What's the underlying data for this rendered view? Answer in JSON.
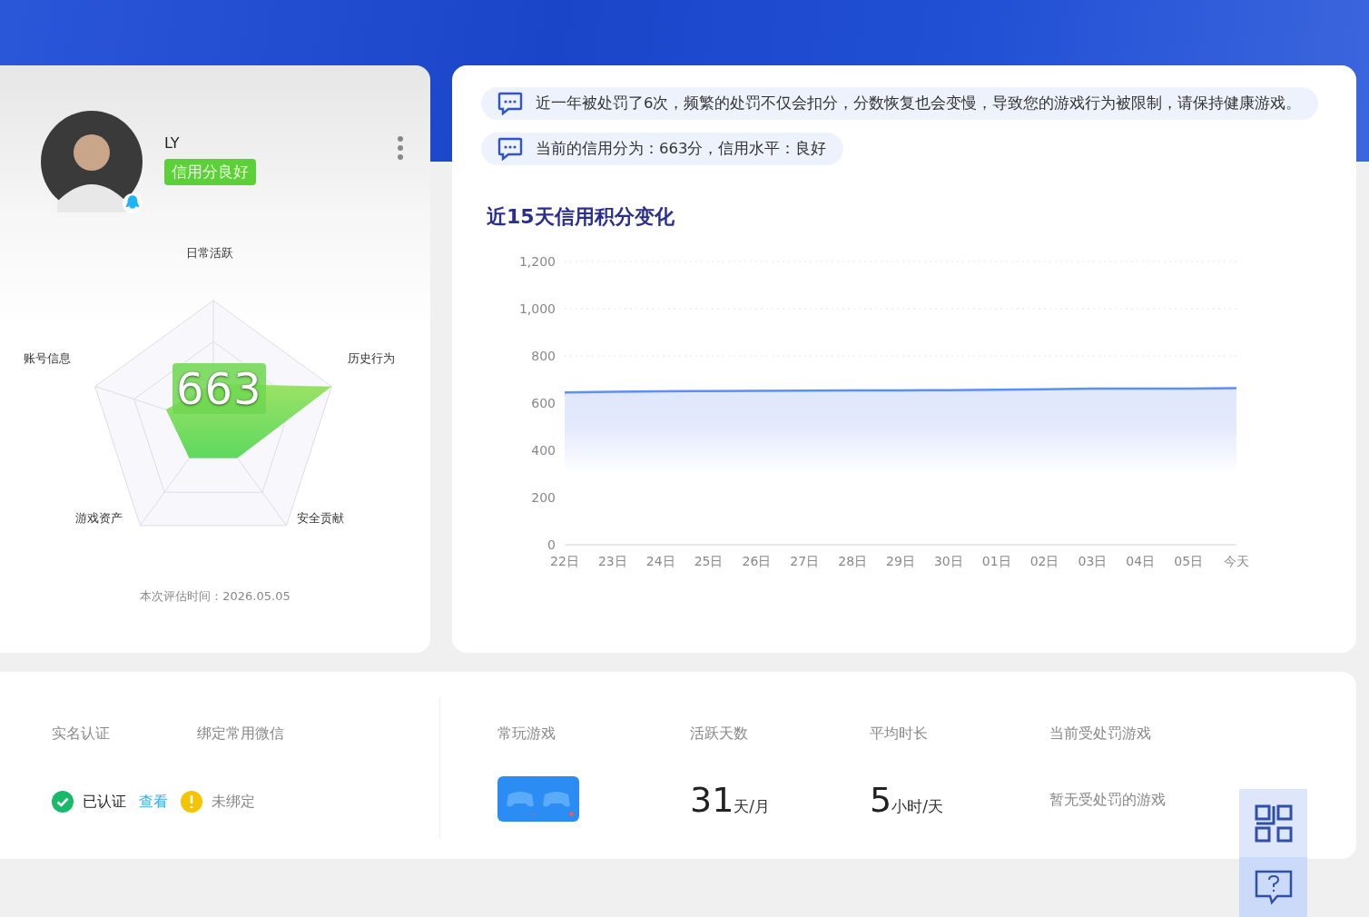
{
  "profile": {
    "name": "LY",
    "badge": "信用分良好",
    "score": "663",
    "radar_labels": [
      "日常活跃",
      "历史行为",
      "安全贡献",
      "游戏资产",
      "账号信息"
    ],
    "eval_time": "本次评估时间：2026.05.05"
  },
  "notices": [
    "近一年被处罚了6次，频繁的处罚不仅会扣分，分数恢复也会变慢，导致您的游戏行为被限制，请保持健康游戏。",
    "当前的信用分为：663分，信用水平：良好"
  ],
  "chart": {
    "title": "近15天信用积分变化",
    "chart_data": {
      "type": "area",
      "categories": [
        "22日",
        "23日",
        "24日",
        "25日",
        "26日",
        "27日",
        "28日",
        "29日",
        "30日",
        "01日",
        "02日",
        "03日",
        "04日",
        "05日",
        "今天"
      ],
      "series": [
        {
          "color": "#5b8ff9",
          "values": [
            645,
            648,
            650,
            651,
            652,
            653,
            654,
            654,
            655,
            657,
            659,
            662,
            662,
            662,
            663
          ]
        }
      ],
      "ylim": [
        0,
        1200
      ],
      "yticks": [
        0,
        {
          "value": 200,
          "label": "200"
        },
        {
          "value": 400,
          "label": "400"
        },
        {
          "value": 600,
          "label": "600"
        },
        {
          "value": 800,
          "label": "800"
        },
        {
          "value": 1000,
          "label": "1,000"
        },
        {
          "value": 1200,
          "label": "1,200"
        }
      ]
    }
  },
  "identity": {
    "columns": [
      "实名认证",
      "绑定常用微信"
    ],
    "real_name": {
      "verified": true,
      "status": "已认证",
      "link": "查看"
    },
    "wechat": {
      "bound": false,
      "status": "未绑定"
    }
  },
  "stats": {
    "games_label": "常玩游戏",
    "items": [
      {
        "label": "活跃天数",
        "value": "31",
        "unit": "天/月"
      },
      {
        "label": "平均时长",
        "value": "5",
        "unit": "小时/天"
      }
    ],
    "penalty": {
      "label": "当前受处罚游戏",
      "text": "暂无受处罚的游戏"
    }
  }
}
